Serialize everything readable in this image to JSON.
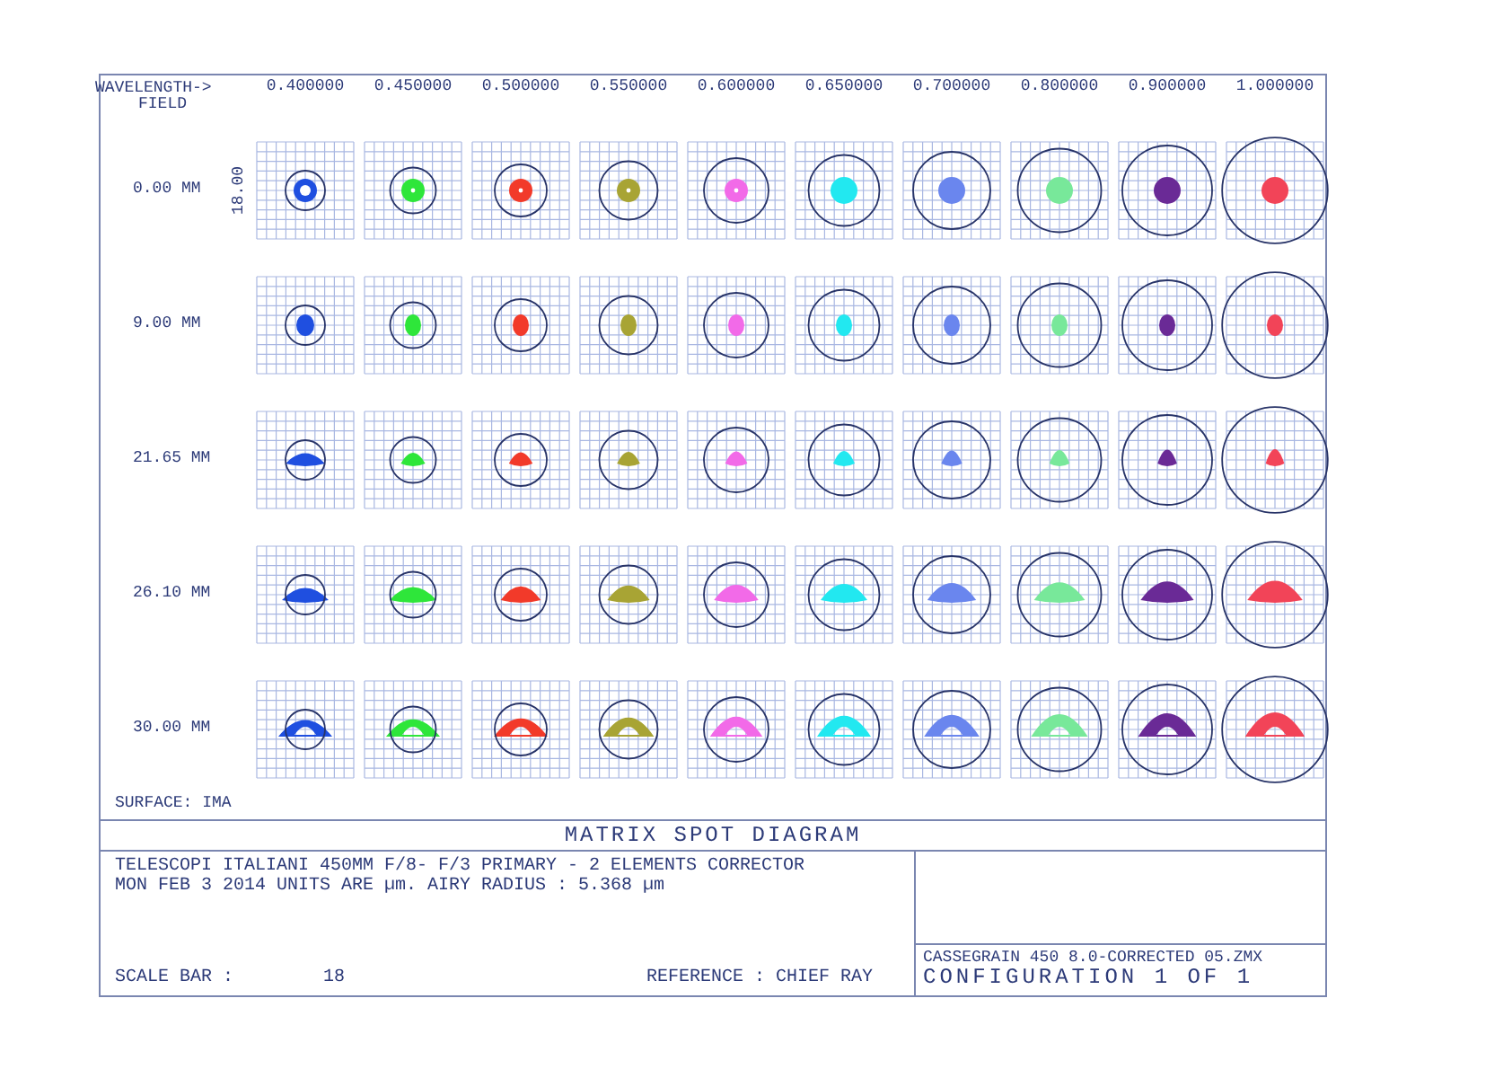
{
  "header": {
    "wavelength_label": "WAVELENGTH->",
    "field_label": "FIELD"
  },
  "scale_bar_label": "18.00",
  "wavelengths": [
    {
      "label": "0.400000",
      "color": "#1f4fe0"
    },
    {
      "label": "0.450000",
      "color": "#2ee63a"
    },
    {
      "label": "0.500000",
      "color": "#f23a2a"
    },
    {
      "label": "0.550000",
      "color": "#a8a434"
    },
    {
      "label": "0.600000",
      "color": "#f26ae8"
    },
    {
      "label": "0.650000",
      "color": "#22e8f0"
    },
    {
      "label": "0.700000",
      "color": "#6a86ee"
    },
    {
      "label": "0.800000",
      "color": "#78e89a"
    },
    {
      "label": "0.900000",
      "color": "#6a2a96"
    },
    {
      "label": "1.000000",
      "color": "#f24458"
    }
  ],
  "fields": [
    {
      "label": "0.00 MM",
      "kind": "ring"
    },
    {
      "label": "9.00 MM",
      "kind": "oval"
    },
    {
      "label": "21.65 MM",
      "kind": "dome"
    },
    {
      "label": "26.10 MM",
      "kind": "arc"
    },
    {
      "label": "30.00 MM",
      "kind": "wide-arc"
    }
  ],
  "surface": "SURFACE: IMA",
  "title": "MATRIX SPOT DIAGRAM",
  "info_lines": [
    "TELESCOPI ITALIANI 450MM F/8- F/3 PRIMARY -  2 ELEMENTS CORRECTOR",
    "MON FEB 3 2014  UNITS ARE µm.  AIRY RADIUS : 5.368 µm"
  ],
  "scale_bar": {
    "label": "SCALE BAR  :",
    "value": "18"
  },
  "reference": {
    "label": "REFERENCE  :",
    "value": "CHIEF RAY"
  },
  "file_name": "CASSEGRAIN 450 8.0-CORRECTED 05.ZMX",
  "configuration": "CONFIGURATION 1 OF 1"
}
